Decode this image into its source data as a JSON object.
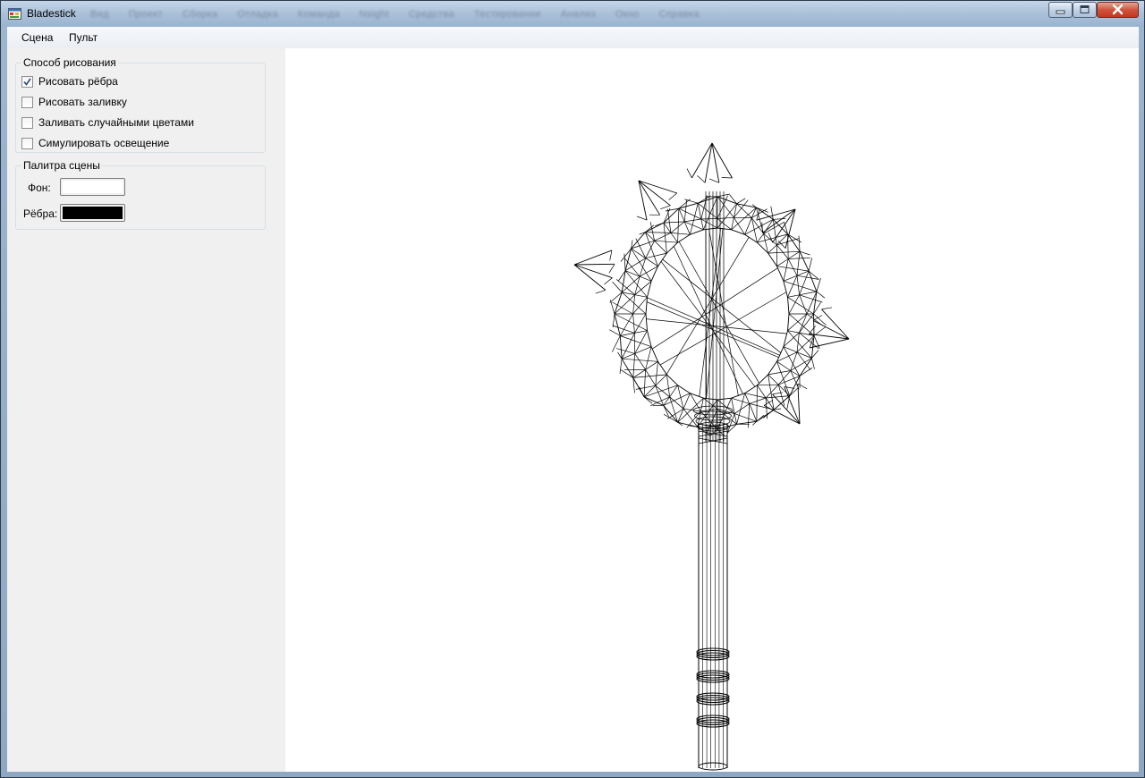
{
  "window": {
    "title": "Bladestick",
    "background_menu_blurred": [
      "Вид",
      "Проект",
      "Сборка",
      "Отладка",
      "Команда",
      "Nsight",
      "Средства",
      "Тестирование",
      "Анализ",
      "Окно",
      "Справка"
    ]
  },
  "menubar": {
    "items": [
      {
        "label": "Сцена"
      },
      {
        "label": "Пульт"
      }
    ]
  },
  "draw_mode": {
    "title": "Способ рисования",
    "options": [
      {
        "label": "Рисовать рёбра",
        "checked": true
      },
      {
        "label": "Рисовать заливку",
        "checked": false
      },
      {
        "label": "Заливать случайными цветами",
        "checked": false
      },
      {
        "label": "Симулировать освещение",
        "checked": false
      }
    ]
  },
  "palette": {
    "title": "Палитра сцены",
    "background_label": "Фон:",
    "background_color": "#ffffff",
    "edges_label": "Рёбра:",
    "edges_color": "#000000"
  },
  "viewport": {
    "background": "#ffffff",
    "stroke": "#000000",
    "model": "wireframe-bladestick"
  }
}
